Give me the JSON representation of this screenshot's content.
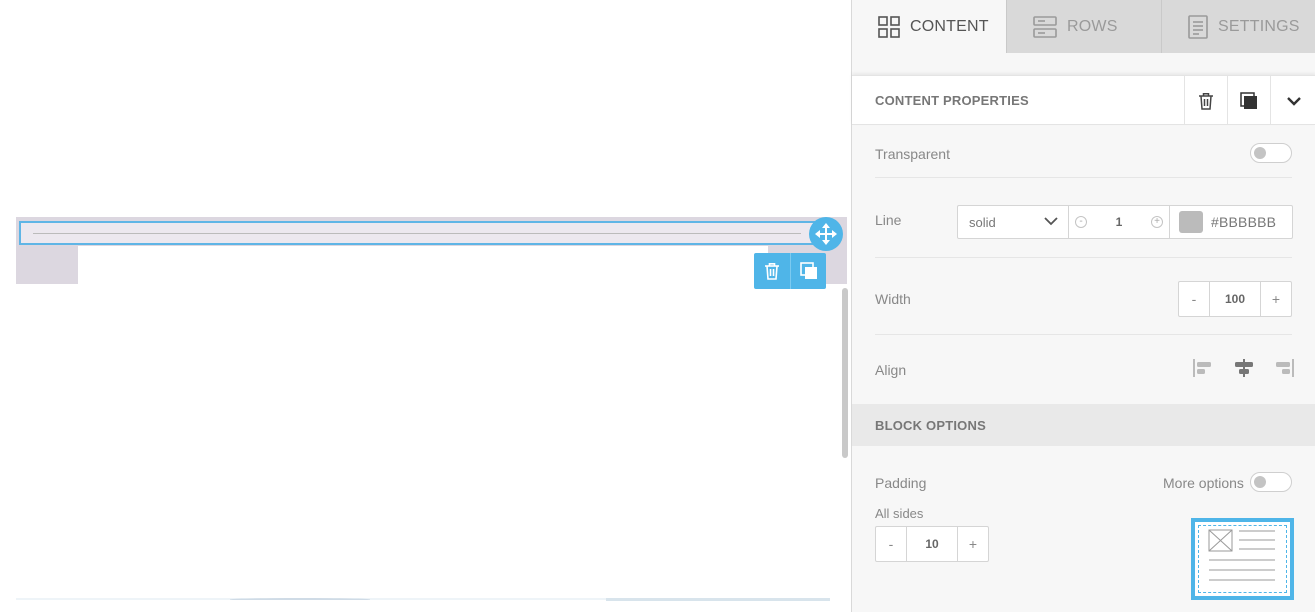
{
  "tabs": [
    {
      "label": "CONTENT",
      "icon": "grid-icon",
      "active": true
    },
    {
      "label": "ROWS",
      "icon": "rows-icon",
      "active": false
    },
    {
      "label": "SETTINGS",
      "icon": "settings-doc-icon",
      "active": false
    }
  ],
  "content_properties": {
    "title": "CONTENT PROPERTIES",
    "transparent_label": "Transparent",
    "transparent_on": false,
    "line_label": "Line",
    "line_style": "solid",
    "line_thickness": "1",
    "line_color": "#BBBBBB",
    "width_label": "Width",
    "width_value": "100",
    "align_label": "Align",
    "align_selected": "center"
  },
  "block_options": {
    "title": "BLOCK OPTIONS",
    "padding_label": "Padding",
    "more_options_label": "More options",
    "more_options_on": false,
    "all_sides_label": "All sides",
    "padding_value": "10"
  },
  "stepper": {
    "minus": "-",
    "plus": "+"
  },
  "colors": {
    "accent": "#4fb5e8",
    "tab_bar": "#d9d9d9",
    "panel_bg": "#f7f7f7",
    "selection_band": "#dcd7e0",
    "divider_line": "#bbbbbb"
  }
}
